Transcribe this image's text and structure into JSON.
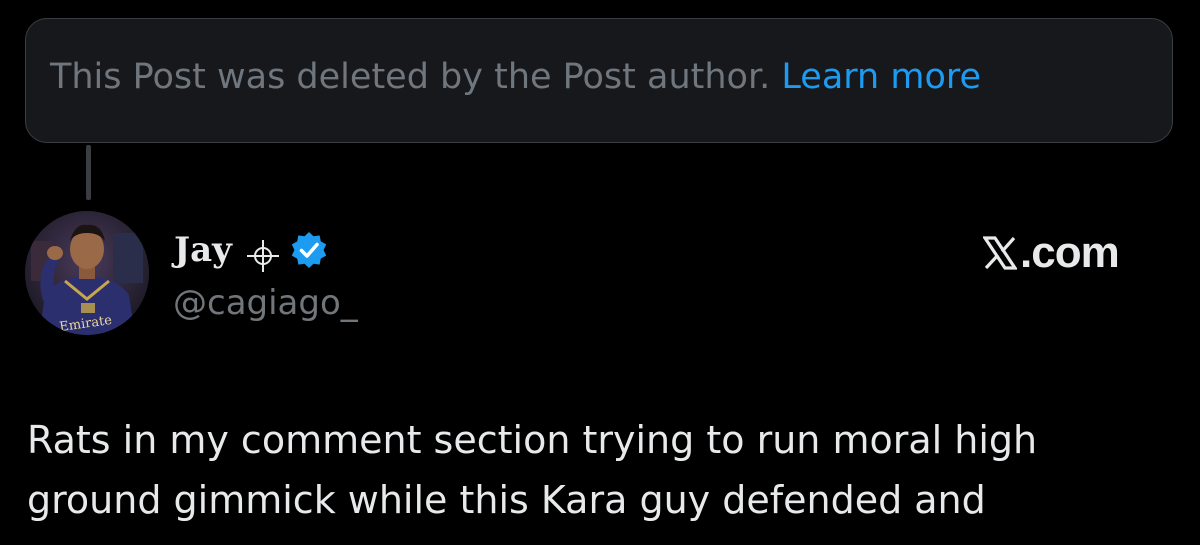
{
  "deleted_notice": {
    "text": "This Post was deleted by the Post author.",
    "link_label": "Learn more"
  },
  "author": {
    "display_name": "Jay",
    "handle": "@cagiago_",
    "avatar_shirt_text": "Emirate",
    "badges": [
      "crosshair-icon",
      "verified-icon"
    ]
  },
  "brand": {
    "label": ".com",
    "icon": "x-logo-icon"
  },
  "post": {
    "lines": [
      "Rats in my comment section trying to run moral high",
      "ground gimmick while this Kara guy defended and"
    ]
  },
  "colors": {
    "background": "#000000",
    "notice_box": "#17181b",
    "link": "#1d9bf0",
    "verified": "#1d9bf0",
    "muted_text": "#71767b",
    "primary_text": "#e7e9ea"
  }
}
